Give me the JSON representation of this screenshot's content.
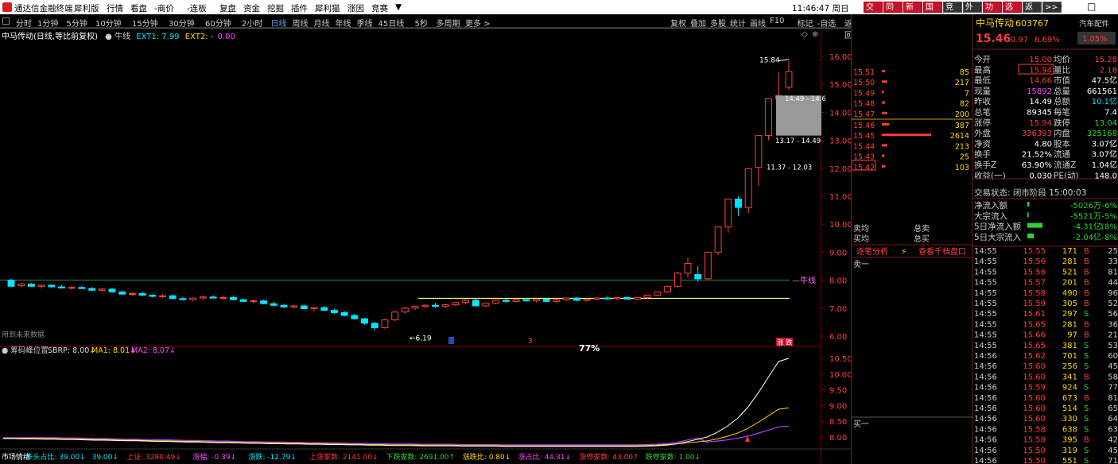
{
  "app": {
    "title": "通达信金融终端",
    "clock": "11:46:47 周日",
    "window_controls": "─ □ ✕"
  },
  "menu": [
    "犀利版",
    "行情",
    "看盘",
    "-商价",
    "-连板",
    "复盘",
    "资金",
    "挖掘",
    "插件",
    "犀利猫",
    "涨因",
    "竞赛",
    "▼"
  ],
  "top_tabs": [
    {
      "label": "交易",
      "style": "red"
    },
    {
      "label": "同花",
      "style": "red"
    },
    {
      "label": "新闻",
      "style": "red"
    },
    {
      "label": "国队",
      "style": "red"
    },
    {
      "label": "竞价",
      "style": "dark"
    },
    {
      "label": "外资",
      "style": "dark"
    },
    {
      "label": "功能",
      "style": "red"
    },
    {
      "label": "选项",
      "style": "red"
    },
    {
      "label": "返回",
      "style": "dark"
    },
    {
      "label": ">>",
      "style": "dark"
    }
  ],
  "periods": [
    {
      "label": "分时",
      "sel": false
    },
    {
      "label": "1分钟",
      "sel": false
    },
    {
      "label": "5分钟",
      "sel": false
    },
    {
      "label": "10分钟",
      "sel": false
    },
    {
      "label": "15分钟",
      "sel": false
    },
    {
      "label": "30分钟",
      "sel": false
    },
    {
      "label": "60分钟",
      "sel": false
    },
    {
      "label": "2小时",
      "sel": false
    },
    {
      "label": "日线",
      "sel": true
    },
    {
      "label": "周线",
      "sel": false
    },
    {
      "label": "月线",
      "sel": false
    },
    {
      "label": "年线",
      "sel": false
    },
    {
      "label": "季线",
      "sel": false
    },
    {
      "label": "45日线",
      "sel": false
    },
    {
      "label": "5秒",
      "sel": false
    },
    {
      "label": "多周期",
      "sel": false
    },
    {
      "label": "更多 >",
      "sel": false
    }
  ],
  "period_tools": [
    "复权",
    "叠加",
    "多股",
    "统计",
    "画线",
    "F10",
    "标记",
    "-自选",
    "返回"
  ],
  "chart": {
    "stock_line": "中马传动(日线,等比前复权)",
    "indicator_name": "● 牛线",
    "ext1": "EXT1: 7.99",
    "ext2": "EXT2: -",
    "ext2_val": "0.00",
    "bull_label": "牛线",
    "future_note": "用到未来数据",
    "low_label": "6.19",
    "high_label": "15.84",
    "range1": "14.49 - 14.6",
    "range2": "13.17 - 14.49",
    "range3": "11.37 - 12.03",
    "mark_s": "3",
    "pct_label": "77%",
    "limit_badge": "涨 跌",
    "sub_title": "● 筹码峰位置",
    "sbrp": "SBRP: 8.00↓",
    "ma1": "MA1: 8.01↓",
    "ma2": "MA2: 8.07↓"
  },
  "chart_data": {
    "type": "candlestick",
    "price_axis": [
      "16.00",
      "15.00",
      "14.00",
      "13.00",
      "12.00",
      "11.00",
      "10.00",
      "9.00",
      "8.00",
      "7.00",
      "6.00"
    ],
    "price_ylim": [
      5.8,
      16.5
    ],
    "sub_axis": [
      "10.50",
      "10.00",
      "9.50",
      "9.00",
      "8.50",
      "8.00"
    ],
    "bull_line": 8.0,
    "support_line": 7.35,
    "ohlc": [
      [
        8.0,
        8.05,
        7.75,
        7.78
      ],
      [
        7.8,
        7.9,
        7.74,
        7.86
      ],
      [
        7.86,
        7.9,
        7.76,
        7.78
      ],
      [
        7.78,
        7.84,
        7.7,
        7.82
      ],
      [
        7.82,
        7.85,
        7.74,
        7.76
      ],
      [
        7.76,
        7.82,
        7.7,
        7.72
      ],
      [
        7.72,
        7.78,
        7.66,
        7.74
      ],
      [
        7.74,
        7.8,
        7.68,
        7.7
      ],
      [
        7.7,
        7.76,
        7.62,
        7.64
      ],
      [
        7.64,
        7.72,
        7.6,
        7.68
      ],
      [
        7.68,
        7.72,
        7.55,
        7.58
      ],
      [
        7.58,
        7.62,
        7.48,
        7.5
      ],
      [
        7.5,
        7.56,
        7.44,
        7.52
      ],
      [
        7.52,
        7.58,
        7.44,
        7.46
      ],
      [
        7.46,
        7.5,
        7.38,
        7.42
      ],
      [
        7.42,
        7.5,
        7.36,
        7.44
      ],
      [
        7.44,
        7.48,
        7.32,
        7.34
      ],
      [
        7.34,
        7.4,
        7.28,
        7.3
      ],
      [
        7.3,
        7.38,
        7.24,
        7.36
      ],
      [
        7.36,
        7.44,
        7.3,
        7.4
      ],
      [
        7.4,
        7.46,
        7.34,
        7.36
      ],
      [
        7.36,
        7.42,
        7.3,
        7.38
      ],
      [
        7.38,
        7.44,
        7.28,
        7.3
      ],
      [
        7.3,
        7.34,
        7.2,
        7.24
      ],
      [
        7.24,
        7.3,
        7.16,
        7.26
      ],
      [
        7.26,
        7.3,
        7.14,
        7.16
      ],
      [
        7.16,
        7.22,
        7.06,
        7.1
      ],
      [
        7.1,
        7.16,
        7.0,
        7.04
      ],
      [
        7.04,
        7.12,
        6.98,
        7.08
      ],
      [
        7.08,
        7.12,
        6.96,
        6.98
      ],
      [
        6.98,
        7.04,
        6.9,
        7.02
      ],
      [
        7.02,
        7.06,
        6.9,
        6.92
      ],
      [
        6.92,
        6.98,
        6.8,
        6.84
      ],
      [
        6.84,
        6.9,
        6.7,
        6.74
      ],
      [
        6.74,
        6.8,
        6.58,
        6.62
      ],
      [
        6.62,
        6.66,
        6.4,
        6.46
      ],
      [
        6.46,
        6.5,
        6.19,
        6.3
      ],
      [
        6.3,
        6.62,
        6.26,
        6.58
      ],
      [
        6.58,
        6.9,
        6.54,
        6.86
      ],
      [
        6.86,
        7.05,
        6.8,
        7.0
      ],
      [
        7.0,
        7.1,
        6.94,
        7.06
      ],
      [
        7.06,
        7.14,
        7.0,
        7.1
      ],
      [
        7.1,
        7.18,
        7.02,
        7.06
      ],
      [
        7.06,
        7.14,
        7.0,
        7.12
      ],
      [
        7.12,
        7.22,
        7.08,
        7.2
      ],
      [
        7.2,
        7.32,
        7.14,
        7.28
      ],
      [
        7.28,
        7.34,
        7.06,
        7.08
      ],
      [
        7.08,
        7.2,
        7.04,
        7.18
      ],
      [
        7.18,
        7.3,
        7.14,
        7.28
      ],
      [
        7.28,
        7.34,
        7.2,
        7.24
      ],
      [
        7.24,
        7.32,
        7.2,
        7.3
      ],
      [
        7.3,
        7.36,
        7.22,
        7.26
      ],
      [
        7.26,
        7.34,
        7.2,
        7.32
      ],
      [
        7.32,
        7.38,
        7.22,
        7.24
      ],
      [
        7.24,
        7.34,
        7.18,
        7.3
      ],
      [
        7.3,
        7.38,
        7.26,
        7.36
      ],
      [
        7.36,
        7.4,
        7.24,
        7.28
      ],
      [
        7.28,
        7.36,
        7.22,
        7.32
      ],
      [
        7.32,
        7.4,
        7.28,
        7.36
      ],
      [
        7.36,
        7.42,
        7.3,
        7.34
      ],
      [
        7.34,
        7.4,
        7.28,
        7.38
      ],
      [
        7.38,
        7.42,
        7.3,
        7.32
      ],
      [
        7.32,
        7.4,
        7.28,
        7.38
      ],
      [
        7.38,
        7.48,
        7.34,
        7.46
      ],
      [
        7.46,
        7.6,
        7.42,
        7.58
      ],
      [
        7.58,
        7.8,
        7.54,
        7.78
      ],
      [
        7.78,
        8.3,
        7.74,
        8.25
      ],
      [
        8.25,
        8.8,
        8.1,
        8.6
      ],
      [
        8.2,
        8.5,
        7.95,
        8.05
      ],
      [
        8.05,
        9.0,
        8.0,
        9.0
      ],
      [
        9.0,
        9.9,
        8.9,
        9.9
      ],
      [
        9.9,
        10.9,
        9.7,
        10.9
      ],
      [
        10.9,
        11.0,
        10.3,
        10.6
      ],
      [
        10.6,
        12.0,
        10.4,
        11.98
      ],
      [
        12.03,
        13.17,
        11.37,
        13.17
      ],
      [
        13.17,
        14.49,
        13.0,
        14.49
      ],
      [
        14.49,
        15.45,
        14.49,
        14.6
      ],
      [
        14.9,
        15.84,
        14.8,
        15.46
      ]
    ],
    "sub_lines": {
      "white": [
        7.95,
        7.95,
        7.94,
        7.94,
        7.93,
        7.93,
        7.92,
        7.92,
        7.91,
        7.9,
        7.9,
        7.89,
        7.88,
        7.88,
        7.87,
        7.86,
        7.86,
        7.85,
        7.84,
        7.84,
        7.83,
        7.82,
        7.82,
        7.81,
        7.8,
        7.8,
        7.79,
        7.79,
        7.78,
        7.78,
        7.77,
        7.77,
        7.76,
        7.76,
        7.75,
        7.75,
        7.74,
        7.74,
        7.73,
        7.73,
        7.73,
        7.72,
        7.72,
        7.72,
        7.72,
        7.71,
        7.71,
        7.71,
        7.71,
        7.7,
        7.7,
        7.7,
        7.7,
        7.7,
        7.7,
        7.7,
        7.7,
        7.7,
        7.7,
        7.7,
        7.7,
        7.7,
        7.7,
        7.71,
        7.72,
        7.74,
        7.78,
        7.85,
        7.92,
        8.0,
        8.15,
        8.35,
        8.6,
        8.95,
        9.4,
        9.9,
        10.4,
        10.5
      ]
    }
  },
  "quote": {
    "name": "中马传动",
    "code": "603767",
    "sector": "汽车配件",
    "price": "15.46",
    "chg": "0.97",
    "pct": "6.69%",
    "turn_box": "1.05%",
    "fields": [
      [
        "今开",
        "15.00",
        "red",
        "均价",
        "15.28",
        "red"
      ],
      [
        "最高",
        "15.94",
        "red",
        "量比",
        "2.18",
        "red"
      ],
      [
        "最低",
        "14.66",
        "red",
        "市值",
        "47.5亿",
        "wht"
      ],
      [
        "现量",
        "15892",
        "mag",
        "总量",
        "661561",
        "wht"
      ],
      [
        "昨收",
        "14.49",
        "wht",
        "总额",
        "10.1亿",
        "cyn"
      ],
      [
        "总笔",
        "89345",
        "wht",
        "每笔",
        "7.4",
        "wht"
      ],
      [
        "涨停",
        "15.94",
        "red",
        "跌停",
        "13.04",
        "grn"
      ],
      [
        "外盘",
        "336393",
        "red",
        "内盘",
        "325168",
        "grn"
      ],
      [
        "净资",
        "4.80",
        "wht",
        "股本",
        "3.07亿",
        "wht"
      ],
      [
        "换手",
        "21.52%",
        "wht",
        "流通",
        "3.07亿",
        "wht"
      ],
      [
        "换手Z",
        "63.90%",
        "wht",
        "流通Z",
        "1.04亿",
        "wht"
      ],
      [
        "收益(一)",
        "0.030",
        "wht",
        "PE(动)",
        "148.0",
        "wht"
      ]
    ],
    "trade_status": "交易状态: 闭市阶段 15:00:03",
    "flows": [
      [
        "净流入额",
        "-5026万",
        "-6%"
      ],
      [
        "大宗流入",
        "-5521万",
        "-5%"
      ],
      [
        "5日净流入额",
        "-4.31亿",
        "-18%"
      ],
      [
        "5日大宗流入",
        "-2.04亿",
        "-8%"
      ]
    ],
    "flow_width": [
      8,
      4,
      100,
      40
    ]
  },
  "orderbook": {
    "asks": [
      [
        "15.51",
        "85"
      ],
      [
        "15.50",
        "217"
      ],
      [
        "15.49",
        "7"
      ],
      [
        "15.48",
        "82"
      ],
      [
        "15.47",
        "200"
      ]
    ],
    "bids": [
      [
        "15.46",
        "387"
      ],
      [
        "15.45",
        "2614"
      ],
      [
        "15.44",
        "213"
      ],
      [
        "15.43",
        "25"
      ],
      [
        "15.42",
        "103"
      ]
    ],
    "ask_bar": [
      3,
      8,
      1,
      3,
      8
    ],
    "bid_bar": [
      12,
      100,
      8,
      2,
      4
    ]
  },
  "mid_panel": {
    "sell_avg": "卖均",
    "total_sell": "总卖",
    "buy_avg": "买均",
    "total_buy": "总买",
    "tab1": "逐笔分析",
    "tab2": "查看千档盘口",
    "sell1": "卖一",
    "buy1": "买一"
  },
  "trades": [
    [
      "14:55",
      "15.55",
      "171",
      "B",
      "25"
    ],
    [
      "14:55",
      "15.56",
      "281",
      "B",
      "33"
    ],
    [
      "14:55",
      "15.56",
      "521",
      "B",
      "81"
    ],
    [
      "14:55",
      "15.57",
      "201",
      "B",
      "44"
    ],
    [
      "14:55",
      "15.58",
      "490",
      "B",
      "96"
    ],
    [
      "14:55",
      "15.59",
      "305",
      "B",
      "52"
    ],
    [
      "14:55",
      "15.61",
      "297",
      "S",
      "56"
    ],
    [
      "14:55",
      "15.65",
      "281",
      "B",
      "36"
    ],
    [
      "14:55",
      "15.66",
      "97",
      "B",
      "21"
    ],
    [
      "14:55",
      "15.65",
      "381",
      "S",
      "53"
    ],
    [
      "14:56",
      "15.62",
      "701",
      "S",
      "60"
    ],
    [
      "14:56",
      "15.60",
      "256",
      "S",
      "45"
    ],
    [
      "14:56",
      "15.60",
      "341",
      "B",
      "58"
    ],
    [
      "14:56",
      "15.59",
      "924",
      "S",
      "77"
    ],
    [
      "14:56",
      "15.60",
      "673",
      "B",
      "81"
    ],
    [
      "14:56",
      "15.60",
      "514",
      "S",
      "65"
    ],
    [
      "14:56",
      "15.60",
      "330",
      "S",
      "64"
    ],
    [
      "14:56",
      "15.58",
      "638",
      "S",
      "63"
    ],
    [
      "14:56",
      "15.58",
      "395",
      "B",
      "42"
    ],
    [
      "14:56",
      "15.50",
      "319",
      "S",
      "45"
    ],
    [
      "14:56",
      "15.50",
      "551",
      "S",
      "71"
    ]
  ],
  "status_bar": [
    [
      "市场情绪",
      "wht"
    ],
    [
      "多头占比: 39.00↓",
      "cyn"
    ],
    [
      "39.00↓",
      "cyn"
    ],
    [
      "上证: 3280.49↓",
      "red"
    ],
    [
      "涨幅: -0.39↓",
      "mag"
    ],
    [
      "涨跌: -12.79↓",
      "cyn"
    ],
    [
      "上涨家数: 2141.00↓",
      "red"
    ],
    [
      "下跌家数: 2691.00↑",
      "grn"
    ],
    [
      "涨跌比: 0.80↓",
      "yel"
    ],
    [
      "涨占比: 44.31↓",
      "mag"
    ],
    [
      "涨停家数: 43.00↑",
      "red"
    ],
    [
      "跌停家数: 1.00↓",
      "grn"
    ]
  ]
}
